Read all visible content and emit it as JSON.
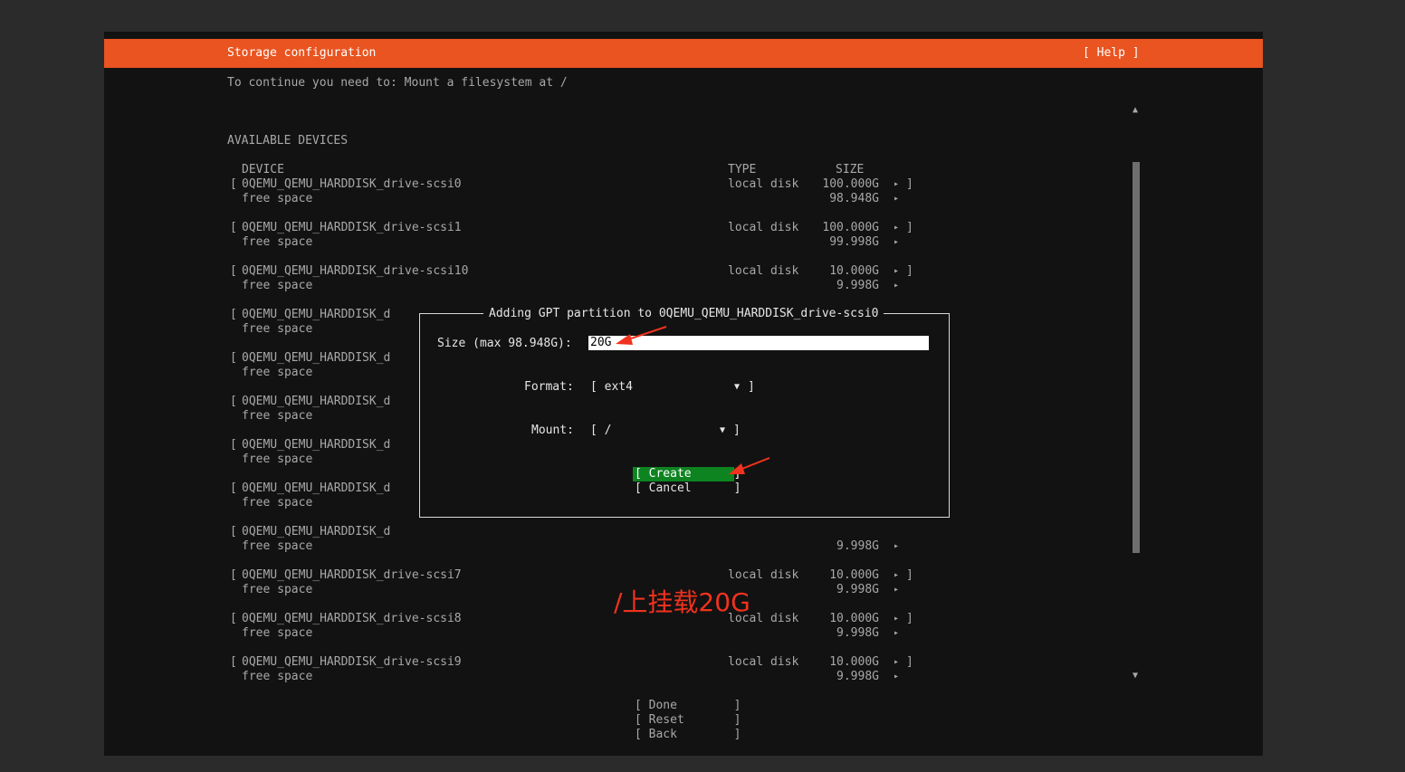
{
  "header": {
    "title": "Storage configuration",
    "help": "[ Help ]"
  },
  "notice": "To continue you need to: Mount a filesystem at /",
  "section_title": "AVAILABLE DEVICES",
  "columns": {
    "device": "DEVICE",
    "type": "TYPE",
    "size": "SIZE"
  },
  "devices": [
    {
      "name": "0QEMU_QEMU_HARDDISK_drive-scsi0",
      "type": "local disk",
      "size": "100.000G",
      "free_label": "free space",
      "free_size": "98.948G"
    },
    {
      "name": "0QEMU_QEMU_HARDDISK_drive-scsi1",
      "type": "local disk",
      "size": "100.000G",
      "free_label": "free space",
      "free_size": "99.998G"
    },
    {
      "name": "0QEMU_QEMU_HARDDISK_drive-scsi10",
      "type": "local disk",
      "size": "10.000G",
      "free_label": "free space",
      "free_size": "9.998G"
    },
    {
      "name": "0QEMU_QEMU_HARDDISK_d",
      "free_label": "free space"
    },
    {
      "name": "0QEMU_QEMU_HARDDISK_d",
      "free_label": "free space"
    },
    {
      "name": "0QEMU_QEMU_HARDDISK_d",
      "free_label": "free space"
    },
    {
      "name": "0QEMU_QEMU_HARDDISK_d",
      "free_label": "free space"
    },
    {
      "name": "0QEMU_QEMU_HARDDISK_d",
      "free_label": "free space"
    },
    {
      "name": "0QEMU_QEMU_HARDDISK_d",
      "free_label": "free space",
      "free_size": "9.998G"
    },
    {
      "name": "0QEMU_QEMU_HARDDISK_drive-scsi7",
      "type": "local disk",
      "size": "10.000G",
      "free_label": "free space",
      "free_size": "9.998G"
    },
    {
      "name": "0QEMU_QEMU_HARDDISK_drive-scsi8",
      "type": "local disk",
      "size": "10.000G",
      "free_label": "free space",
      "free_size": "9.998G"
    },
    {
      "name": "0QEMU_QEMU_HARDDISK_drive-scsi9",
      "type": "local disk",
      "size": "10.000G",
      "free_label": "free space",
      "free_size": "9.998G"
    }
  ],
  "glyphs": {
    "bracket_open": "[",
    "bracket_close": "]",
    "arrow_right": "▸",
    "scroll_up": "▲",
    "scroll_down": "▼",
    "dropdown": "▼"
  },
  "dialog": {
    "title": "Adding GPT partition to 0QEMU_QEMU_HARDDISK_drive-scsi0",
    "size_label": "Size (max 98.948G):",
    "size_value": "20G",
    "format_label": "Format:",
    "format_value": "[ ext4",
    "mount_label": "Mount:",
    "mount_value": "[ /",
    "create_label": "[ Create      ]",
    "cancel_label": "[ Cancel      ]"
  },
  "bottom_buttons": {
    "done": "[ Done        ]",
    "reset": "[ Reset       ]",
    "back": "[ Back        ]"
  },
  "annotation": {
    "text": "/上挂载20G",
    "color": "#f0321e"
  },
  "colors": {
    "header_bg": "#e95420",
    "terminal_bg": "#121212",
    "create_bg": "#0e8420",
    "page_bg": "#2b2b2b"
  }
}
